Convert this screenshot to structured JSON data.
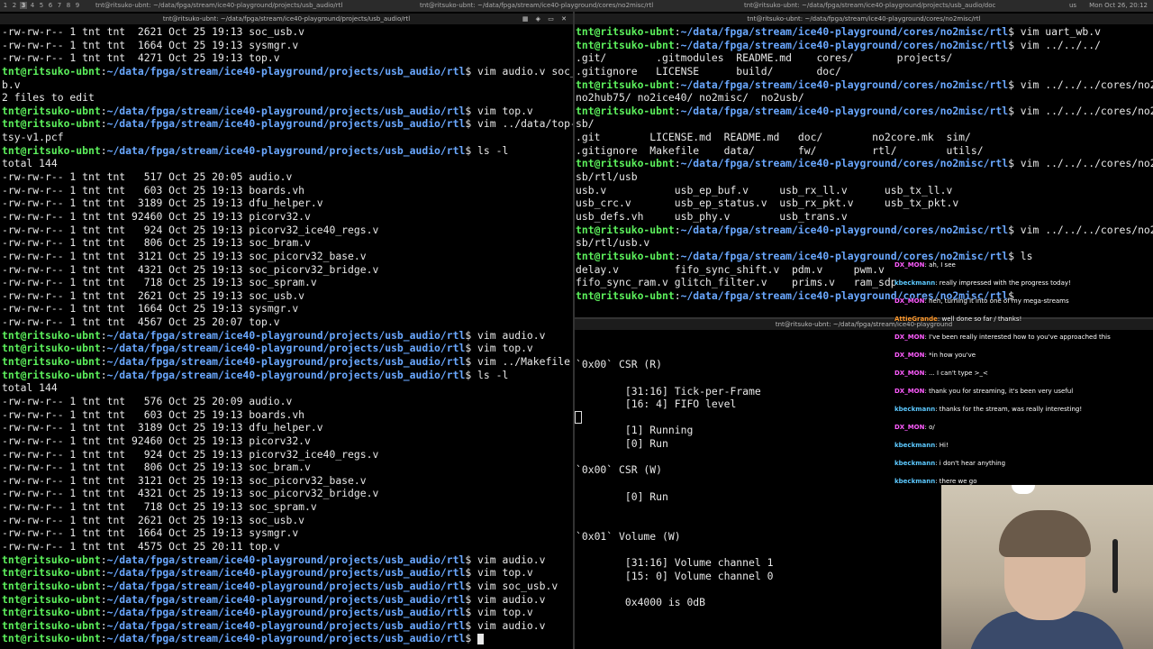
{
  "topbar": {
    "workspaces": [
      "1",
      "2",
      "3",
      "4",
      "5",
      "6",
      "7",
      "8",
      "9"
    ],
    "active_workspace": "3",
    "title_left": "tnt@ritsuko-ubnt: ~/data/fpga/stream/ice40-playground/projects/usb_audio/rtl",
    "title_mid": "tnt@ritsuko-ubnt: ~/data/fpga/stream/ice40-playground/cores/no2misc/rtl",
    "title_right": "tnt@ritsuko-ubnt: ~/data/fpga/stream/ice40-playground/projects/usb_audio/doc",
    "locale": "us",
    "clock": "Mon Oct 26, 20:12"
  },
  "left_window_title": "tnt@ritsuko-ubnt: ~/data/fpga/stream/ice40-playground/projects/usb_audio/rtl",
  "right_top_title": "tnt@ritsuko-ubnt: ~/data/fpga/stream/ice40-playground/cores/no2misc/rtl",
  "right_bottom_title": "tnt@ritsuko-ubnt: ~/data/fpga/stream/ice40-playground",
  "prompt": {
    "user": "tnt@ritsuko-ubnt",
    "path_left": "~/data/fpga/stream/ice40-playground/projects/usb_audio/rtl",
    "path_right": "~/data/fpga/stream/ice40-playground/cores/no2misc/rtl"
  },
  "left_terminal": [
    {
      "t": "text",
      "v": "-rw-rw-r-- 1 tnt tnt  2621 Oct 25 19:13 soc_usb.v"
    },
    {
      "t": "text",
      "v": "-rw-rw-r-- 1 tnt tnt  1664 Oct 25 19:13 sysmgr.v"
    },
    {
      "t": "text",
      "v": "-rw-rw-r-- 1 tnt tnt  4271 Oct 25 19:13 top.v"
    },
    {
      "t": "prompt",
      "v": "$ vim audio.v soc_us"
    },
    {
      "t": "text",
      "v": "b.v"
    },
    {
      "t": "text",
      "v": "2 files to edit"
    },
    {
      "t": "prompt",
      "v": "$ vim top.v"
    },
    {
      "t": "prompt",
      "v": "$ vim ../data/top-bi"
    },
    {
      "t": "text",
      "v": "tsy-v1.pcf"
    },
    {
      "t": "prompt",
      "v": "$ ls -l"
    },
    {
      "t": "text",
      "v": "total 144"
    },
    {
      "t": "text",
      "v": "-rw-rw-r-- 1 tnt tnt   517 Oct 25 20:05 audio.v"
    },
    {
      "t": "text",
      "v": "-rw-rw-r-- 1 tnt tnt   603 Oct 25 19:13 boards.vh"
    },
    {
      "t": "text",
      "v": "-rw-rw-r-- 1 tnt tnt  3189 Oct 25 19:13 dfu_helper.v"
    },
    {
      "t": "text",
      "v": "-rw-rw-r-- 1 tnt tnt 92460 Oct 25 19:13 picorv32.v"
    },
    {
      "t": "text",
      "v": "-rw-rw-r-- 1 tnt tnt   924 Oct 25 19:13 picorv32_ice40_regs.v"
    },
    {
      "t": "text",
      "v": "-rw-rw-r-- 1 tnt tnt   806 Oct 25 19:13 soc_bram.v"
    },
    {
      "t": "text",
      "v": "-rw-rw-r-- 1 tnt tnt  3121 Oct 25 19:13 soc_picorv32_base.v"
    },
    {
      "t": "text",
      "v": "-rw-rw-r-- 1 tnt tnt  4321 Oct 25 19:13 soc_picorv32_bridge.v"
    },
    {
      "t": "text",
      "v": "-rw-rw-r-- 1 tnt tnt   718 Oct 25 19:13 soc_spram.v"
    },
    {
      "t": "text",
      "v": "-rw-rw-r-- 1 tnt tnt  2621 Oct 25 19:13 soc_usb.v"
    },
    {
      "t": "text",
      "v": "-rw-rw-r-- 1 tnt tnt  1664 Oct 25 19:13 sysmgr.v"
    },
    {
      "t": "text",
      "v": "-rw-rw-r-- 1 tnt tnt  4567 Oct 25 20:07 top.v"
    },
    {
      "t": "prompt",
      "v": "$ vim audio.v"
    },
    {
      "t": "prompt",
      "v": "$ vim top.v"
    },
    {
      "t": "prompt",
      "v": "$ vim ../Makefile"
    },
    {
      "t": "prompt",
      "v": "$ ls -l"
    },
    {
      "t": "text",
      "v": "total 144"
    },
    {
      "t": "text",
      "v": "-rw-rw-r-- 1 tnt tnt   576 Oct 25 20:09 audio.v"
    },
    {
      "t": "text",
      "v": "-rw-rw-r-- 1 tnt tnt   603 Oct 25 19:13 boards.vh"
    },
    {
      "t": "text",
      "v": "-rw-rw-r-- 1 tnt tnt  3189 Oct 25 19:13 dfu_helper.v"
    },
    {
      "t": "text",
      "v": "-rw-rw-r-- 1 tnt tnt 92460 Oct 25 19:13 picorv32.v"
    },
    {
      "t": "text",
      "v": "-rw-rw-r-- 1 tnt tnt   924 Oct 25 19:13 picorv32_ice40_regs.v"
    },
    {
      "t": "text",
      "v": "-rw-rw-r-- 1 tnt tnt   806 Oct 25 19:13 soc_bram.v"
    },
    {
      "t": "text",
      "v": "-rw-rw-r-- 1 tnt tnt  3121 Oct 25 19:13 soc_picorv32_base.v"
    },
    {
      "t": "text",
      "v": "-rw-rw-r-- 1 tnt tnt  4321 Oct 25 19:13 soc_picorv32_bridge.v"
    },
    {
      "t": "text",
      "v": "-rw-rw-r-- 1 tnt tnt   718 Oct 25 19:13 soc_spram.v"
    },
    {
      "t": "text",
      "v": "-rw-rw-r-- 1 tnt tnt  2621 Oct 25 19:13 soc_usb.v"
    },
    {
      "t": "text",
      "v": "-rw-rw-r-- 1 tnt tnt  1664 Oct 25 19:13 sysmgr.v"
    },
    {
      "t": "text",
      "v": "-rw-rw-r-- 1 tnt tnt  4575 Oct 25 20:11 top.v"
    },
    {
      "t": "prompt",
      "v": "$ vim audio.v"
    },
    {
      "t": "prompt",
      "v": "$ vim top.v"
    },
    {
      "t": "prompt",
      "v": "$ vim soc_usb.v"
    },
    {
      "t": "prompt",
      "v": "$ vim audio.v"
    },
    {
      "t": "prompt",
      "v": "$ vim top.v"
    },
    {
      "t": "prompt",
      "v": "$ vim audio.v"
    },
    {
      "t": "prompt_cursor",
      "v": "$ "
    }
  ],
  "right_top_terminal": [
    {
      "t": "prompt",
      "v": "$ vim uart_wb.v"
    },
    {
      "t": "prompt",
      "v": "$ vim ../../../"
    },
    {
      "t": "text",
      "v": ".git/        .gitmodules  README.md    cores/       projects/"
    },
    {
      "t": "text",
      "v": ".gitignore   LICENSE      build/       doc/"
    },
    {
      "t": "prompt",
      "v": "$ vim ../../../cores/no2"
    },
    {
      "t": "text",
      "v": "no2hub75/ no2ice40/ no2misc/  no2usb/"
    },
    {
      "t": "prompt",
      "v": "$ vim ../../../cores/no2u"
    },
    {
      "t": "text",
      "v": "sb/"
    },
    {
      "t": "text",
      "v": ".git        LICENSE.md  README.md   doc/        no2core.mk  sim/"
    },
    {
      "t": "text",
      "v": ".gitignore  Makefile    data/       fw/         rtl/        utils/"
    },
    {
      "t": "prompt",
      "v": "$ vim ../../../cores/no2u"
    },
    {
      "t": "text",
      "v": "sb/rtl/usb"
    },
    {
      "t": "text",
      "v": "usb.v           usb_ep_buf.v     usb_rx_ll.v      usb_tx_ll.v"
    },
    {
      "t": "text",
      "v": "usb_crc.v       usb_ep_status.v  usb_rx_pkt.v     usb_tx_pkt.v"
    },
    {
      "t": "text",
      "v": "usb_defs.vh     usb_phy.v        usb_trans.v"
    },
    {
      "t": "prompt",
      "v": "$ vim ../../../cores/no2u"
    },
    {
      "t": "text",
      "v": "sb/rtl/usb.v"
    },
    {
      "t": "prompt",
      "v": "$ ls"
    },
    {
      "t": "text",
      "v": "delay.v         fifo_sync_shift.v  pdm.v     pwm.v"
    },
    {
      "t": "text",
      "v": "fifo_sync_ram.v glitch_filter.v    prims.v   ram_sdp"
    },
    {
      "t": "prompt",
      "v": "$ "
    }
  ],
  "right_bottom_terminal": [
    "",
    "",
    "`0x00` CSR (R)",
    "",
    "        [31:16] Tick-per-Frame",
    "        [16: 4] FIFO level",
    "",
    "        [1] Running",
    "        [0] Run",
    "",
    "`0x00` CSR (W)",
    "",
    "        [0] Run",
    "",
    "",
    "`0x01` Volume (W)",
    "",
    "        [31:16] Volume channel 1",
    "        [15: 0] Volume channel 0",
    "",
    "        0x4000 is 0dB"
  ],
  "chat": [
    {
      "nick": "DX_MON",
      "color": "#ff5cff",
      "text": "ah, I see"
    },
    {
      "nick": "kbeckmann",
      "color": "#5cc8ff",
      "text": "really impressed with the progress today!"
    },
    {
      "nick": "DX_MON",
      "color": "#ff5cff",
      "text": "heh, turning it into one of my mega-streams"
    },
    {
      "nick": "AttieGrande",
      "color": "#ff9a2e",
      "text": "well done so far / thanks!"
    },
    {
      "nick": "DX_MON",
      "color": "#ff5cff",
      "text": "I've been really interested how to you've approached this"
    },
    {
      "nick": "DX_MON",
      "color": "#ff5cff",
      "text": "*in how you've"
    },
    {
      "nick": "DX_MON",
      "color": "#ff5cff",
      "text": "... I can't type >_<"
    },
    {
      "nick": "DX_MON",
      "color": "#ff5cff",
      "text": "thank you for streaming, it's been very useful"
    },
    {
      "nick": "kbeckmann",
      "color": "#5cc8ff",
      "text": "thanks for the stream, was really interesting!"
    },
    {
      "nick": "DX_MON",
      "color": "#ff5cff",
      "text": "o/"
    },
    {
      "nick": "kbeckmann",
      "color": "#5cc8ff",
      "text": "Hi!"
    },
    {
      "nick": "kbeckmann",
      "color": "#5cc8ff",
      "text": "i don't hear anything"
    },
    {
      "nick": "kbeckmann",
      "color": "#5cc8ff",
      "text": "there we go"
    }
  ],
  "window_controls": "▦ ◈ ▭ ✕"
}
